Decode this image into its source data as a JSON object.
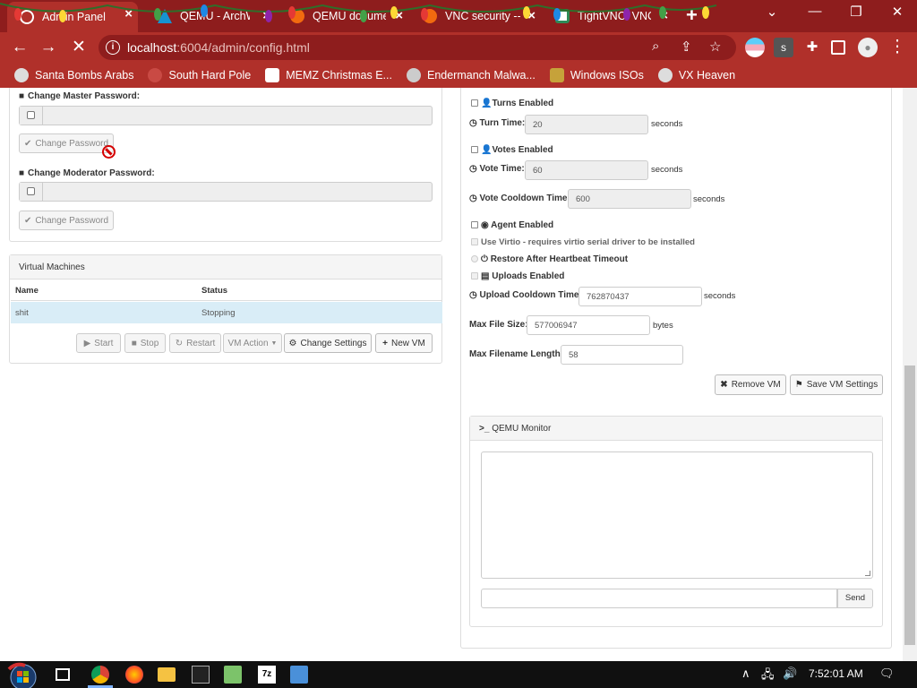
{
  "browser": {
    "tabs": [
      {
        "title": "Admin Panel",
        "active": true
      },
      {
        "title": "QEMU - ArchWiki",
        "active": false
      },
      {
        "title": "QEMU documentation",
        "active": false
      },
      {
        "title": "VNC security --",
        "active": false
      },
      {
        "title": "TightVNC: VNC",
        "active": false
      }
    ],
    "new_tab": "+",
    "url_host": "localhost",
    "url_path": ":6004/admin/config.html",
    "bookmarks": [
      {
        "label": "Santa Bombs Arabs"
      },
      {
        "label": "South Hard Pole"
      },
      {
        "label": "MEMZ Christmas E..."
      },
      {
        "label": "Endermanch Malwa..."
      },
      {
        "label": "Windows ISOs"
      },
      {
        "label": "VX Heaven"
      }
    ],
    "accent": "#b0302a",
    "tab_bar_color": "#8e1d1d"
  },
  "left": {
    "master_label": "Change Master Password:",
    "mod_label": "Change Moderator Password:",
    "change_password_btn": "Change Password",
    "vm_panel_title": "Virtual Machines",
    "table": {
      "headers": [
        "Name",
        "Status"
      ],
      "rows": [
        {
          "name": "shit",
          "status": "Stopping"
        }
      ]
    },
    "buttons": {
      "start": "Start",
      "stop": "Stop",
      "restart": "Restart",
      "vm_action": "VM Action",
      "change_settings": "Change Settings",
      "new_vm": "New VM"
    }
  },
  "right": {
    "turns_enabled": "Turns Enabled",
    "turn_time_label": "Turn Time:",
    "turn_time": "20",
    "votes_enabled": "Votes Enabled",
    "vote_time_label": "Vote Time:",
    "vote_time": "60",
    "vote_cooldown_label": "Vote Cooldown Time:",
    "vote_cooldown": "600",
    "seconds": "seconds",
    "bytes": "bytes",
    "agent_enabled": "Agent Enabled",
    "use_virtio": "Use Virtio - requires virtio serial driver to be installed",
    "restore_heartbeat": "Restore After Heartbeat Timeout",
    "uploads_enabled": "Uploads Enabled",
    "upload_cooldown_label": "Upload Cooldown Time:",
    "upload_cooldown": "762870437",
    "max_file_size_label": "Max File Size:",
    "max_file_size": "577006947",
    "max_filename_label": "Max Filename Length:",
    "max_filename": "58",
    "remove_vm": "Remove VM",
    "save_vm_settings": "Save VM Settings",
    "qemu_title": "QEMU Monitor",
    "send": "Send"
  },
  "taskbar": {
    "clock": "7:52:01 AM"
  }
}
